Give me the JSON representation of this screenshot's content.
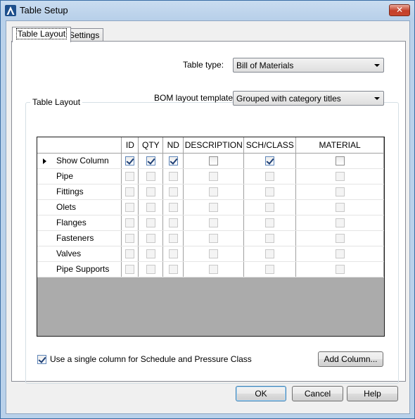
{
  "window": {
    "title": "Table Setup",
    "close_glyph": "✕"
  },
  "tabs": [
    {
      "label": "Table Layout",
      "active": true
    },
    {
      "label": "Settings",
      "active": false
    }
  ],
  "table_type": {
    "label": "Table type:",
    "value": "Bill of Materials"
  },
  "group": {
    "title": "Table Layout",
    "template_label": "BOM layout template:",
    "template_value": "Grouped with category titles"
  },
  "grid": {
    "columns": [
      "ID",
      "QTY",
      "ND",
      "DESCRIPTION",
      "SCH/CLASS",
      "MATERIAL"
    ],
    "rows": [
      {
        "label": "Show Column",
        "enabled": true,
        "current": true,
        "checked": [
          true,
          true,
          true,
          false,
          true,
          false
        ]
      },
      {
        "label": "Pipe",
        "enabled": false,
        "current": false,
        "checked": [
          false,
          false,
          false,
          false,
          false,
          false
        ]
      },
      {
        "label": "Fittings",
        "enabled": false,
        "current": false,
        "checked": [
          false,
          false,
          false,
          false,
          false,
          false
        ]
      },
      {
        "label": "Olets",
        "enabled": false,
        "current": false,
        "checked": [
          false,
          false,
          false,
          false,
          false,
          false
        ]
      },
      {
        "label": "Flanges",
        "enabled": false,
        "current": false,
        "checked": [
          false,
          false,
          false,
          false,
          false,
          false
        ]
      },
      {
        "label": "Fasteners",
        "enabled": false,
        "current": false,
        "checked": [
          false,
          false,
          false,
          false,
          false,
          false
        ]
      },
      {
        "label": "Valves",
        "enabled": false,
        "current": false,
        "checked": [
          false,
          false,
          false,
          false,
          false,
          false
        ]
      },
      {
        "label": "Pipe Supports",
        "enabled": false,
        "current": false,
        "checked": [
          false,
          false,
          false,
          false,
          false,
          false
        ]
      }
    ],
    "empty_area_color": "#ababab"
  },
  "single_column_option": {
    "label": "Use a single column for Schedule and Pressure Class",
    "checked": true
  },
  "add_column_label": "Add Column...",
  "buttons": {
    "ok": "OK",
    "cancel": "Cancel",
    "help": "Help"
  }
}
